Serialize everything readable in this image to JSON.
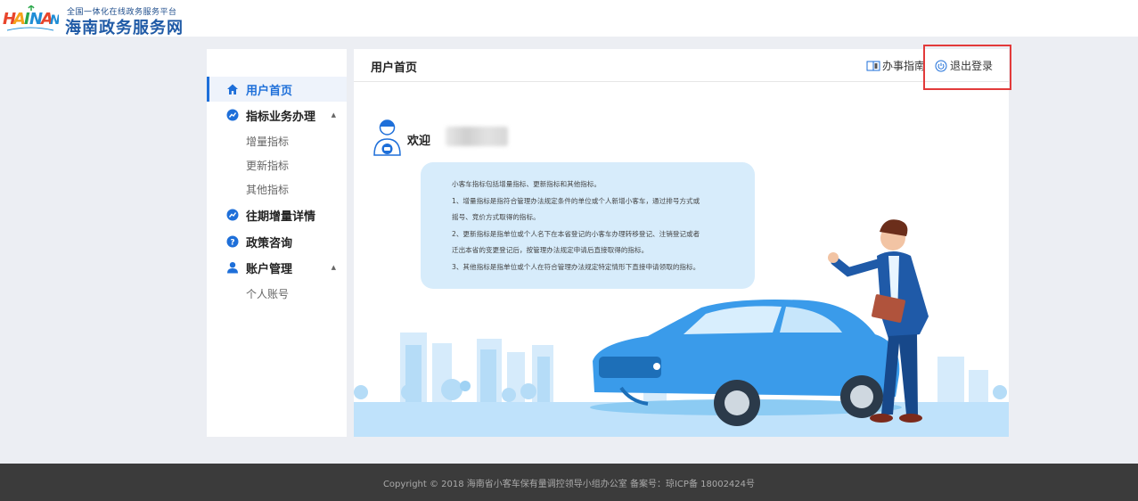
{
  "header": {
    "subtitle": "全国一体化在线政务服务平台",
    "title": "海南政务服务网"
  },
  "sidebar": {
    "items": [
      {
        "label": "用户首页"
      },
      {
        "label": "指标业务办理"
      },
      {
        "label": "往期增量详情"
      },
      {
        "label": "政策咨询"
      },
      {
        "label": "账户管理"
      }
    ],
    "sub_items": {
      "biz": [
        "增量指标",
        "更新指标",
        "其他指标"
      ],
      "account": [
        "个人账号"
      ]
    }
  },
  "main": {
    "title": "用户首页",
    "guide_label": "办事指南",
    "logout_label": "退出登录",
    "welcome": "欢迎",
    "bubble_lines": [
      "小客车指标包括增量指标、更新指标和其他指标。",
      "1、增量指标是指符合管理办法规定条件的单位或个人新增小客车，通过排号方式或",
      "摇号、竞价方式取得的指标。",
      "2、更新指标是指单位或个人名下在本省登记的小客车办理转移登记、注销登记或者",
      "迁出本省的变更登记后，按管理办法规定申请后直接取得的指标。",
      "3、其他指标是指单位或个人在符合管理办法规定特定情形下直接申请领取的指标。"
    ]
  },
  "footer": {
    "text": "Copyright © 2018   海南省小客车保有量调控领导小组办公室   备案号：琼ICP备 18002424号"
  },
  "colors": {
    "accent": "#1e6fd9",
    "highlight_box": "#e23a3a",
    "bubble": "#d7ecfb",
    "footer_bg": "#3b3b3b"
  }
}
